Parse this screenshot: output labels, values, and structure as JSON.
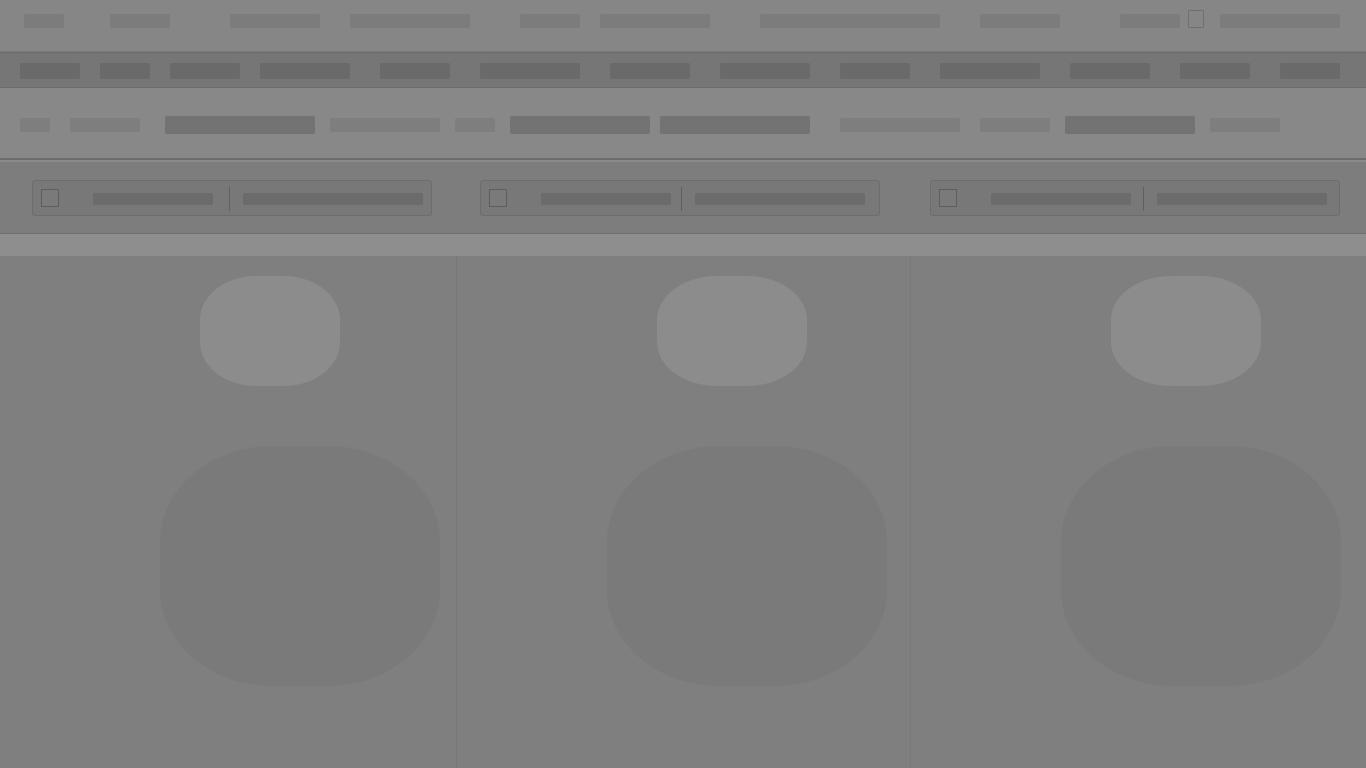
{
  "top_bar": {},
  "menu_bar": {},
  "filter_bar": {},
  "cards": [
    {
      "id": "card-1"
    },
    {
      "id": "card-2"
    },
    {
      "id": "card-3"
    }
  ],
  "gallery": {
    "images": [
      {
        "id": "image-1"
      },
      {
        "id": "image-2"
      },
      {
        "id": "image-3"
      }
    ]
  }
}
